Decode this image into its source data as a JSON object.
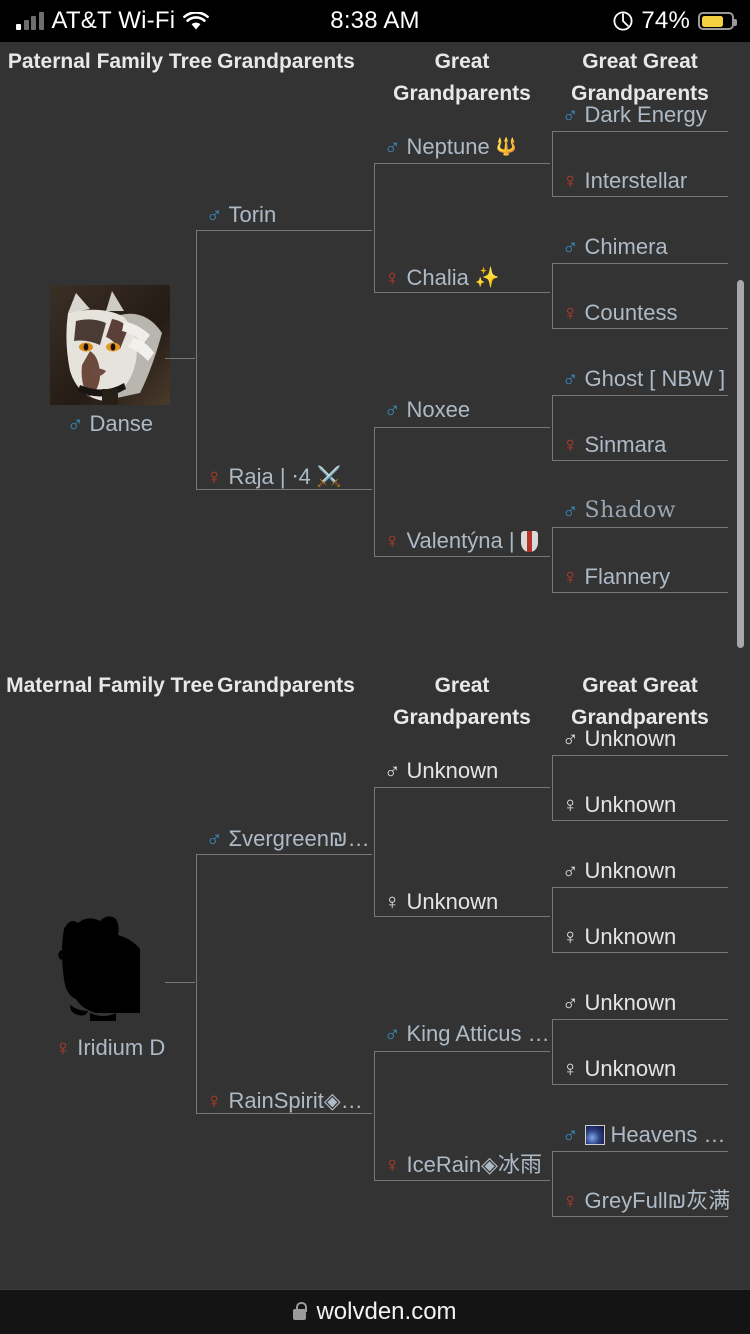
{
  "status_bar": {
    "carrier": "AT&T Wi-Fi",
    "time": "8:38 AM",
    "battery_percent": "74%",
    "battery_color": "#f5d142",
    "lowpower_icon": "lowpower-icon",
    "wifi_icon": "wifi-icon",
    "signal_icon": "cellular-signal-icon"
  },
  "browser_bar": {
    "lock_icon": "lock-icon",
    "url": "wolvden.com"
  },
  "theme": {
    "background": "#333333",
    "box_border": "#787878",
    "link_text": "#aebac6",
    "unknown_text": "#e4e4e4",
    "male_symbol_color": "#3b8ec4",
    "female_symbol_color": "#c0392b",
    "header_text": "#e8e8e8"
  },
  "paternal": {
    "headers": [
      "Paternal Family Tree",
      "Grandparents",
      "Great Grandparents",
      "Great Great Grandparents"
    ],
    "subject": {
      "name": "Danse",
      "sex": "male",
      "symbol": "♂",
      "portrait": "wolf-portrait-grey-white"
    },
    "grandparents": [
      {
        "name": "Torin",
        "sex": "male",
        "symbol": "♂"
      },
      {
        "name": "Raja | ⋅4",
        "sex": "female",
        "symbol": "♀",
        "emoji": "⚔️"
      }
    ],
    "great_grandparents": [
      {
        "name": "Neptune",
        "sex": "male",
        "symbol": "♂",
        "emoji": "🔱"
      },
      {
        "name": "Chalia",
        "sex": "female",
        "symbol": "♀",
        "emoji": "✨"
      },
      {
        "name": "Noxee",
        "sex": "male",
        "symbol": "♂"
      },
      {
        "name": "Valentýna | ",
        "sex": "female",
        "symbol": "♀",
        "emoji": "shield-icon"
      }
    ],
    "great_great_grandparents": [
      {
        "name": "Dark Energy",
        "sex": "male",
        "symbol": "♂"
      },
      {
        "name": "Interstellar",
        "sex": "female",
        "symbol": "♀"
      },
      {
        "name": "Chimera",
        "sex": "male",
        "symbol": "♂"
      },
      {
        "name": "Countess",
        "sex": "female",
        "symbol": "♀"
      },
      {
        "name": "Ghost [ NBW ]",
        "sex": "male",
        "symbol": "♂"
      },
      {
        "name": "Sinmara",
        "sex": "female",
        "symbol": "♀"
      },
      {
        "name": "Shadow",
        "sex": "male",
        "symbol": "♂",
        "style": "fancy"
      },
      {
        "name": "Flannery",
        "sex": "female",
        "symbol": "♀"
      }
    ]
  },
  "maternal": {
    "headers": [
      "Maternal Family Tree",
      "Grandparents",
      "Great Grandparents",
      "Great Great Grandparents"
    ],
    "subject": {
      "name": "Iridium D",
      "sex": "female",
      "symbol": "♀",
      "portrait": "wolf-portrait-black-silhouette"
    },
    "grandparents": [
      {
        "name": "Σvergreen₪…",
        "sex": "male",
        "symbol": "♂"
      },
      {
        "name": "RainSpirit◈…",
        "sex": "female",
        "symbol": "♀"
      }
    ],
    "great_grandparents": [
      {
        "name": "Unknown",
        "sex": "male",
        "symbol": "♂",
        "unknown": true
      },
      {
        "name": "Unknown",
        "sex": "female",
        "symbol": "♀",
        "unknown": true
      },
      {
        "name": "King Atticus …",
        "sex": "male",
        "symbol": "♂"
      },
      {
        "name": "IceRain◈冰雨",
        "sex": "female",
        "symbol": "♀"
      }
    ],
    "great_great_grandparents": [
      {
        "name": "Unknown",
        "sex": "male",
        "symbol": "♂",
        "unknown": true
      },
      {
        "name": "Unknown",
        "sex": "female",
        "symbol": "♀",
        "unknown": true
      },
      {
        "name": "Unknown",
        "sex": "male",
        "symbol": "♂",
        "unknown": true
      },
      {
        "name": "Unknown",
        "sex": "female",
        "symbol": "♀",
        "unknown": true
      },
      {
        "name": "Unknown",
        "sex": "male",
        "symbol": "♂",
        "unknown": true
      },
      {
        "name": "Unknown",
        "sex": "female",
        "symbol": "♀",
        "unknown": true
      },
      {
        "name": "Heavens …",
        "sex": "male",
        "symbol": "♂",
        "emoji": "galaxy-icon"
      },
      {
        "name": "GreyFull₪灰满",
        "sex": "female",
        "symbol": "♀"
      }
    ]
  }
}
